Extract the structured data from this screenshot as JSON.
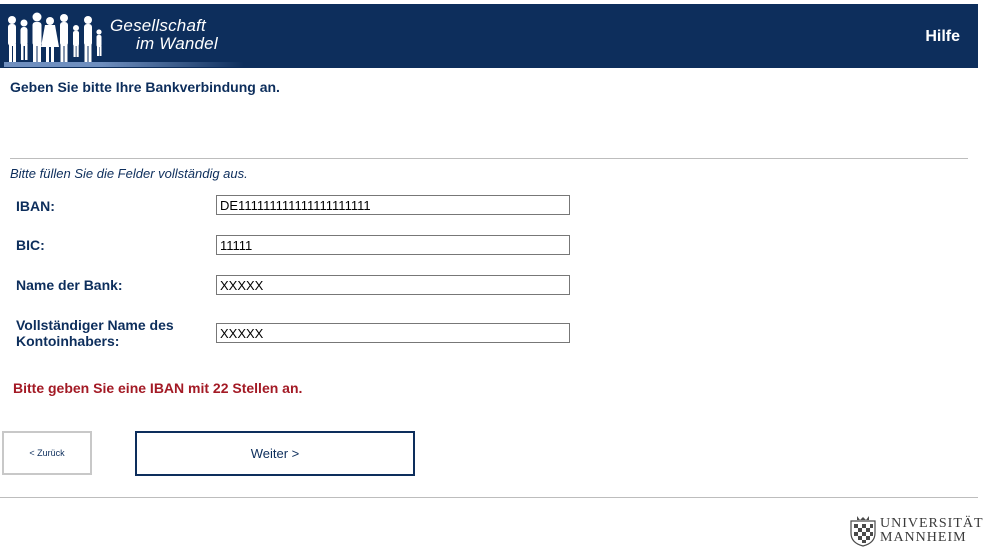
{
  "header": {
    "logo_line1": "Gesellschaft",
    "logo_line2": "im Wandel",
    "help_label": "Hilfe"
  },
  "page": {
    "title": "Geben Sie bitte Ihre Bankverbindung an.",
    "instruction": "Bitte füllen Sie die Felder vollständig aus."
  },
  "form": {
    "fields": [
      {
        "label": "IBAN:",
        "value": "DE111111111111111111111"
      },
      {
        "label": "BIC:",
        "value": "11111"
      },
      {
        "label": "Name der Bank:",
        "value": "XXXXX"
      },
      {
        "label": "Vollständiger Name des Kontoinhabers:",
        "value": "XXXXX"
      }
    ],
    "error": "Bitte geben Sie eine IBAN mit 22 Stellen an."
  },
  "nav": {
    "back_label": "< Zurück",
    "next_label": "Weiter >"
  },
  "footer": {
    "university_line1": "UNIVERSITÄT",
    "university_line2": "MANNHEIM"
  },
  "colors": {
    "header_bg": "#0d2e5c",
    "text_primary": "#0d2e5c",
    "error": "#a31a25",
    "divider": "#bdbdbd"
  },
  "icons": {
    "logo": "people-silhouettes-logo",
    "university": "university-crest-icon"
  }
}
